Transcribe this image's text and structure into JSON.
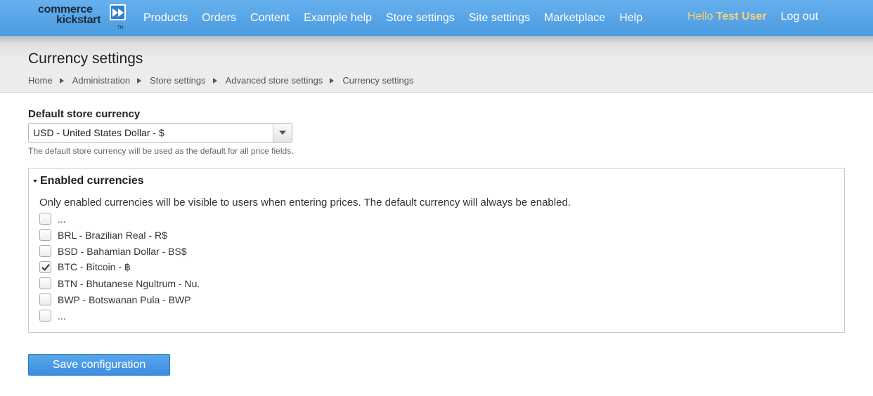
{
  "brand": {
    "line1": "commerce",
    "line2": "kickstart",
    "tm": "TM",
    "accent_color": "#4b9be0"
  },
  "nav": {
    "items": [
      {
        "label": "Products"
      },
      {
        "label": "Orders"
      },
      {
        "label": "Content"
      },
      {
        "label": "Example help"
      },
      {
        "label": "Store settings"
      },
      {
        "label": "Site settings"
      },
      {
        "label": "Marketplace"
      },
      {
        "label": "Help"
      }
    ]
  },
  "user": {
    "hello": "Hello",
    "name": "Test User",
    "logout": "Log out"
  },
  "page": {
    "title": "Currency settings"
  },
  "breadcrumb": [
    {
      "label": "Home"
    },
    {
      "label": "Administration"
    },
    {
      "label": "Store settings"
    },
    {
      "label": "Advanced store settings"
    },
    {
      "label": "Currency settings"
    }
  ],
  "form": {
    "default_currency": {
      "label": "Default store currency",
      "value": "USD - United States Dollar - $",
      "help": "The default store currency will be used as the default for all price fields."
    },
    "enabled_currencies": {
      "legend": "Enabled currencies",
      "description": "Only enabled currencies will be visible to users when entering prices. The default currency will always be enabled.",
      "options": [
        {
          "label": "...",
          "checked": false
        },
        {
          "label": "BRL - Brazilian Real - R$",
          "checked": false
        },
        {
          "label": "BSD - Bahamian Dollar - BS$",
          "checked": false
        },
        {
          "label": "BTC - Bitcoin - ฿",
          "checked": true
        },
        {
          "label": "BTN - Bhutanese Ngultrum - Nu.",
          "checked": false
        },
        {
          "label": "BWP - Botswanan Pula - BWP",
          "checked": false
        },
        {
          "label": "...",
          "checked": false
        }
      ]
    },
    "save_label": "Save configuration"
  }
}
